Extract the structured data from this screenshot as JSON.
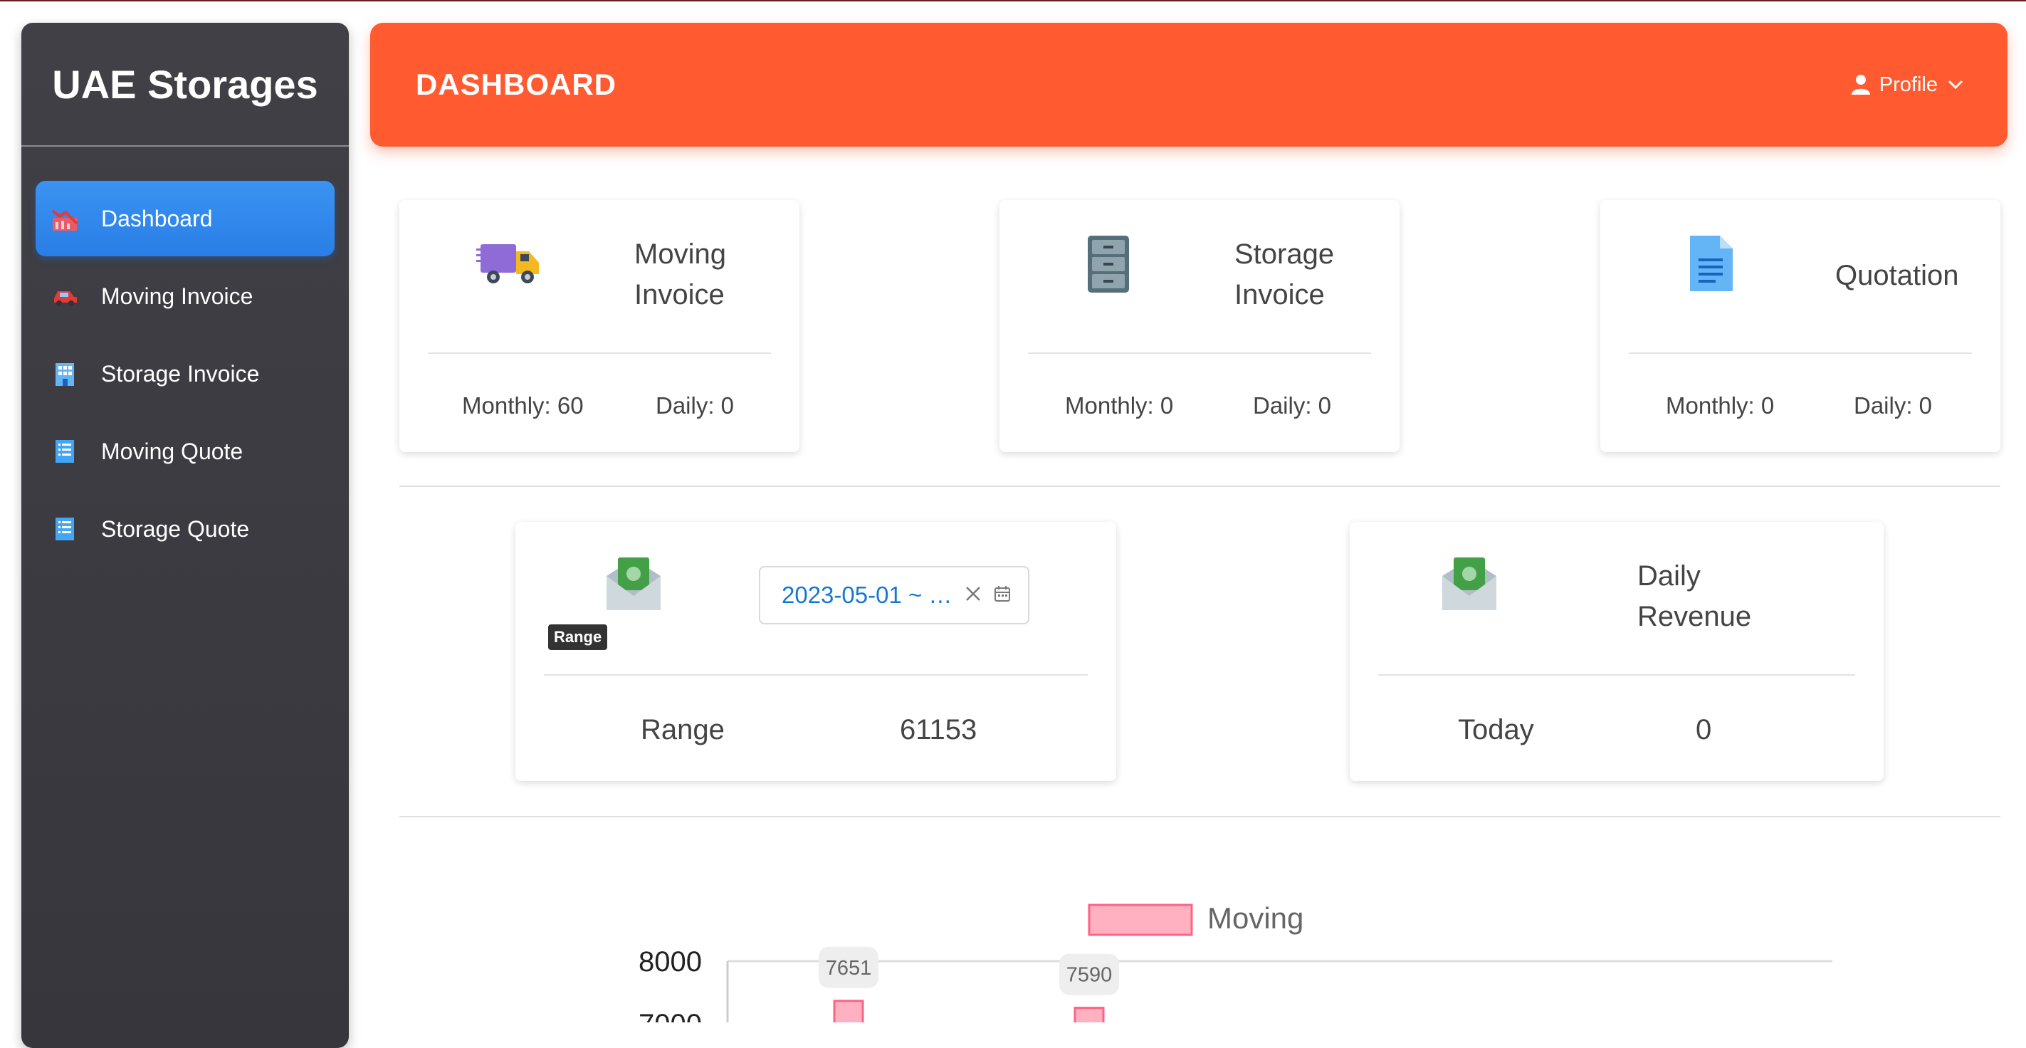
{
  "app": {
    "title": "UAE Storages"
  },
  "sidebar": {
    "items": [
      {
        "label": "Dashboard",
        "icon": "chart-decline-icon",
        "active": true
      },
      {
        "label": "Moving Invoice",
        "icon": "car-icon"
      },
      {
        "label": "Storage Invoice",
        "icon": "office-building-icon"
      },
      {
        "label": "Moving Quote",
        "icon": "list-document-icon"
      },
      {
        "label": "Storage Quote",
        "icon": "list-document-icon"
      }
    ]
  },
  "header": {
    "title": "DASHBOARD",
    "profile_label": "Profile"
  },
  "cards": {
    "moving_invoice": {
      "title_line1": "Moving",
      "title_line2": "Invoice",
      "monthly": "Monthly: 60",
      "daily": "Daily: 0",
      "icon": "delivery-truck-icon"
    },
    "storage_invoice": {
      "title_line1": "Storage",
      "title_line2": "Invoice",
      "monthly": "Monthly: 0",
      "daily": "Daily: 0",
      "icon": "file-cabinet-icon"
    },
    "quotation": {
      "title": "Quotation",
      "monthly": "Monthly: 0",
      "daily": "Daily: 0",
      "icon": "document-icon"
    },
    "range_revenue": {
      "date_range": "2023-05-01 ~ …",
      "tooltip": "Range",
      "label": "Range",
      "value": "61153",
      "icon": "money-envelope-icon"
    },
    "daily_revenue": {
      "title_line1": "Daily",
      "title_line2": "Revenue",
      "label": "Today",
      "value": "0",
      "icon": "money-envelope-icon"
    }
  },
  "colors": {
    "accent": "#ff5a30",
    "active_nav": "#2a7ee6",
    "sidebar": "#3a3a40",
    "bar_fill": "#ffb1c1",
    "bar_border": "#ff6384"
  },
  "chart_data": {
    "type": "bar",
    "legend": [
      "Moving"
    ],
    "data_labels": [
      "7651",
      "7590"
    ],
    "values": [
      7651,
      7590
    ],
    "y_ticks": [
      "8000",
      "7000"
    ],
    "ylim": [
      7000,
      8000
    ]
  }
}
